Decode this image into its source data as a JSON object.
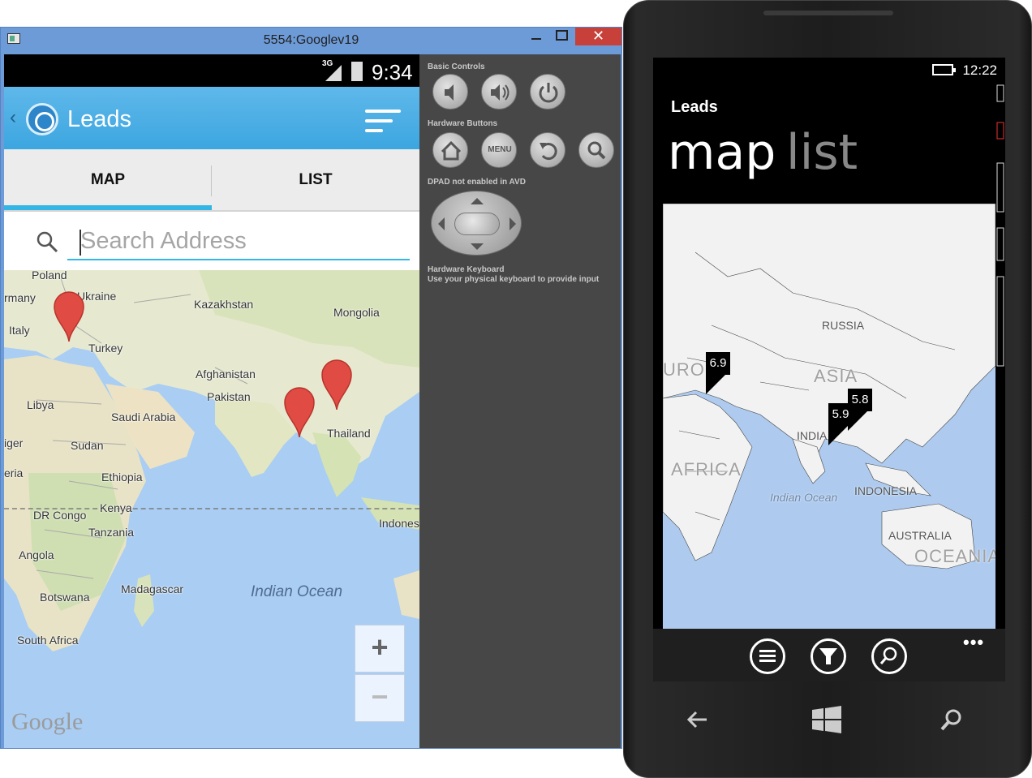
{
  "emulator": {
    "window_title": "5554:Googlev19",
    "close_glyph": "✕",
    "status": {
      "network": "3G",
      "time": "9:34"
    },
    "app": {
      "title": "Leads",
      "tabs": [
        {
          "label": "MAP",
          "selected": true
        },
        {
          "label": "LIST",
          "selected": false
        }
      ],
      "search_placeholder": "Search Address",
      "map": {
        "labels": [
          "Poland",
          "Ukraine",
          "rmany",
          "Italy",
          "Turkey",
          "Kazakhstan",
          "Mongolia",
          "Afghanistan",
          "Pakistan",
          "Libya",
          "Saudi Arabia",
          "Thailand",
          "iger",
          "Sudan",
          "eria",
          "Ethiopia",
          "DR Congo",
          "Kenya",
          "Tanzania",
          "Indones",
          "Angola",
          "Madagascar",
          "Botswana",
          "South Africa"
        ],
        "ocean_label": "Indian Ocean",
        "marker_count": 3,
        "zoom_in": "+",
        "zoom_out": "−",
        "attribution": "Google"
      }
    },
    "controls": {
      "basic_controls": "Basic Controls",
      "hardware_buttons": "Hardware Buttons",
      "menu_label": "MENU",
      "dpad": "DPAD not enabled in AVD",
      "keyboard_title": "Hardware Keyboard",
      "keyboard_hint": "Use your physical keyboard to provide input"
    }
  },
  "windows_phone": {
    "time": "12:22",
    "app_title": "Leads",
    "pivot": [
      {
        "label": "map",
        "active": true
      },
      {
        "label": "list",
        "active": false
      }
    ],
    "map": {
      "labels": {
        "russia": "RUSSIA",
        "india": "INDIA",
        "indonesia": "INDONESIA",
        "australia": "AUSTRALIA"
      },
      "big_labels": {
        "europe": "UROI",
        "asia": "ASIA",
        "africa": "AFRICA",
        "oceania": "OCEANIA"
      },
      "ocean_label": "Indian Ocean",
      "pins": [
        "6.9",
        "5.9",
        "5.8"
      ]
    },
    "appbar_ellipsis": "•••",
    "appbar_buttons": [
      "list-icon",
      "filter-icon",
      "search-icon"
    ]
  },
  "colors": {
    "android_accent": "#33b5e5",
    "actionbar": "#3ca6e0",
    "pin_red": "#e04b43",
    "wp_bg": "#000000"
  }
}
